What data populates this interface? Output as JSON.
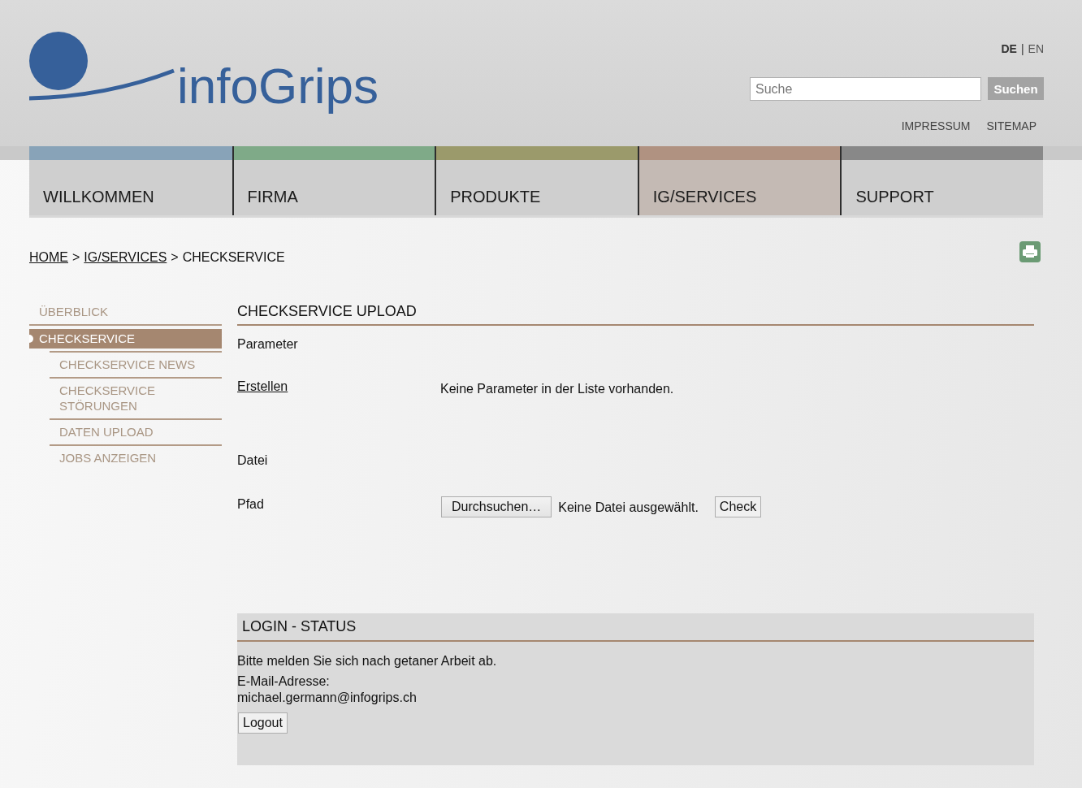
{
  "header": {
    "logo_text": "infoGrips",
    "languages": [
      {
        "label": "DE",
        "selected": true
      },
      {
        "label": "EN",
        "selected": false
      }
    ],
    "language_separator": "|",
    "search": {
      "placeholder": "Suche",
      "button": "Suchen"
    },
    "links": [
      "IMPRESSUM",
      "SITEMAP"
    ]
  },
  "nav": {
    "tabs": [
      {
        "label": "WILLKOMMEN",
        "color": "#88a3b8",
        "selected": false
      },
      {
        "label": "FIRMA",
        "color": "#7faa88",
        "selected": false
      },
      {
        "label": "PRODUKTE",
        "color": "#9b9a6b",
        "selected": false
      },
      {
        "label": "IG/SERVICES",
        "color": "#b09281",
        "selected": true
      },
      {
        "label": "SUPPORT",
        "color": "#888888",
        "selected": false
      }
    ]
  },
  "breadcrumb": {
    "items": [
      {
        "kind": "link",
        "text": "HOME"
      },
      {
        "kind": "separator",
        "text": ">"
      },
      {
        "kind": "link",
        "text": "IG/SERVICES"
      },
      {
        "kind": "separator",
        "text": ">"
      },
      {
        "kind": "current",
        "text": "CHECKSERVICE"
      }
    ]
  },
  "sidebar": {
    "items": [
      {
        "label": "ÜBERBLICK",
        "selected": false
      },
      {
        "label": "CHECKSERVICE",
        "selected": true,
        "children": [
          {
            "label": "CHECKSERVICE NEWS",
            "selected": false
          },
          {
            "label": "CHECKSERVICE STÖRUNGEN",
            "selected": false
          },
          {
            "label": "DATEN UPLOAD",
            "selected": false
          },
          {
            "label": "JOBS ANZEIGEN",
            "selected": false
          }
        ]
      }
    ]
  },
  "upload": {
    "title": "CHECKSERVICE UPLOAD",
    "parameter_heading": "Parameter",
    "create_link": "Erstellen",
    "empty_message": "Keine Parameter in der Liste vorhanden.",
    "file_heading": "Datei",
    "path_label": "Pfad",
    "browse_button": "Durchsuchen…",
    "file_status": "Keine Datei ausgewählt.",
    "check_button": "Check"
  },
  "login_status": {
    "title": "LOGIN - STATUS",
    "message": "Bitte melden Sie sich nach getaner Arbeit ab.",
    "email_label": "E-Mail-Adresse:",
    "email": "michael.germann@infogrips.ch",
    "logout_button": "Logout"
  }
}
